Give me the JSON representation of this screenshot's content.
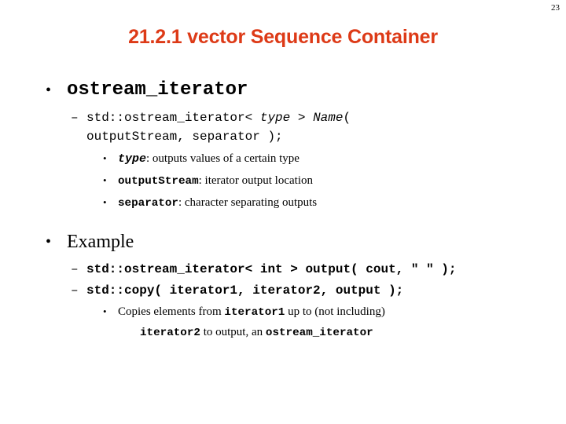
{
  "page": {
    "number": "23",
    "title": "21.2.1 vector Sequence Container",
    "title_color": "#DD3A17",
    "background_color": "#FFFFFF",
    "text_color": "#000000"
  },
  "markers": {
    "bullet_level1": "•",
    "bullet_level2": "–",
    "bullet_level3": "•"
  },
  "sections": [
    {
      "heading": "ostream_iterator",
      "signature": {
        "part1": "std::ostream_iterator< ",
        "type_param": "type",
        "part2": " > ",
        "name_param": "Name",
        "part3": "(",
        "line2": "outputStream, separator );"
      },
      "params": [
        {
          "term": "type",
          "term_style": "mono-italic-bold",
          "description": ": outputs values of a certain type"
        },
        {
          "term": "outputStream",
          "term_style": "mono-bold",
          "description": ": iterator output location"
        },
        {
          "term": "separator",
          "term_style": "mono-bold",
          "description": ": character separating outputs"
        }
      ]
    },
    {
      "heading": "Example",
      "code_lines": [
        "std::ostream_iterator< int > output( cout, \" \" );",
        "std::copy( iterator1, iterator2, output );"
      ],
      "note": {
        "line1_before": "Copies elements from ",
        "line1_code": "iterator1",
        "line1_after": " up to (not including)",
        "line2_code": "iterator2",
        "line2_mid": " to output, an ",
        "line2_code2": "ostream_iterator"
      }
    }
  ]
}
